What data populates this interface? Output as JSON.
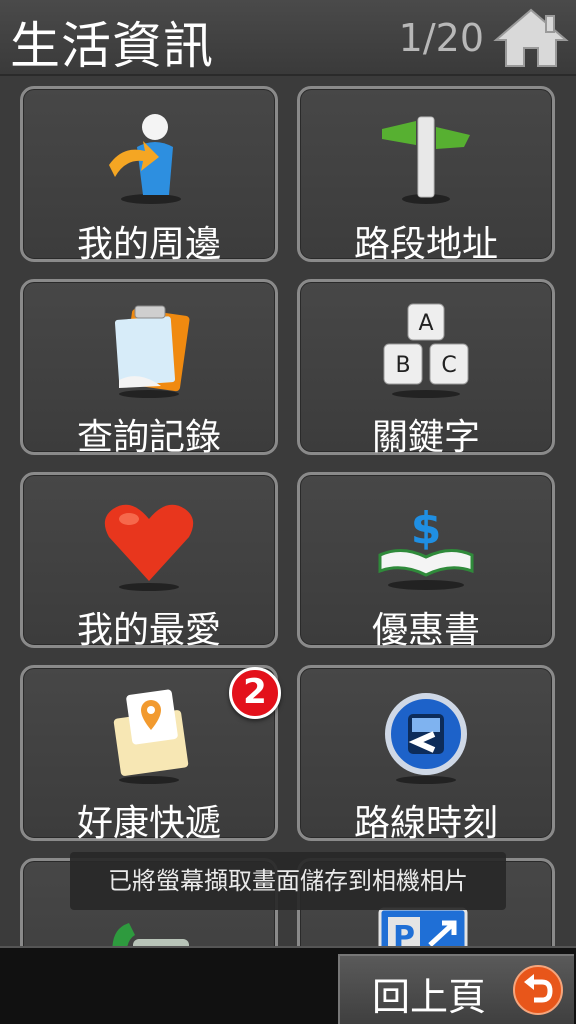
{
  "header": {
    "title": "生活資訊",
    "page_counter": "1/20",
    "home_icon": "home-icon"
  },
  "tiles": [
    {
      "label": "我的周邊",
      "icon": "person-nearby-icon"
    },
    {
      "label": "路段地址",
      "icon": "signpost-icon"
    },
    {
      "label": "查詢記錄",
      "icon": "clipboard-history-icon"
    },
    {
      "label": "關鍵字",
      "icon": "keyboard-abc-icon"
    },
    {
      "label": "我的最愛",
      "icon": "heart-icon"
    },
    {
      "label": "優惠書",
      "icon": "coupon-book-icon"
    },
    {
      "label": "好康快遞",
      "icon": "envelope-location-icon",
      "badge": "2"
    },
    {
      "label": "路線時刻",
      "icon": "bus-icon"
    },
    {
      "label": "",
      "icon": "phone-icon"
    },
    {
      "label": "",
      "icon": "parking-icon"
    }
  ],
  "toast": "已將螢幕擷取畫面儲存到相機相片",
  "footer": {
    "back_label": "回上頁",
    "back_icon": "back-arrow-icon"
  },
  "colors": {
    "background": "#3b3b3b",
    "tile_border": "#8a8a8a",
    "badge_red": "#e3111b",
    "back_orange": "#e8561a"
  }
}
